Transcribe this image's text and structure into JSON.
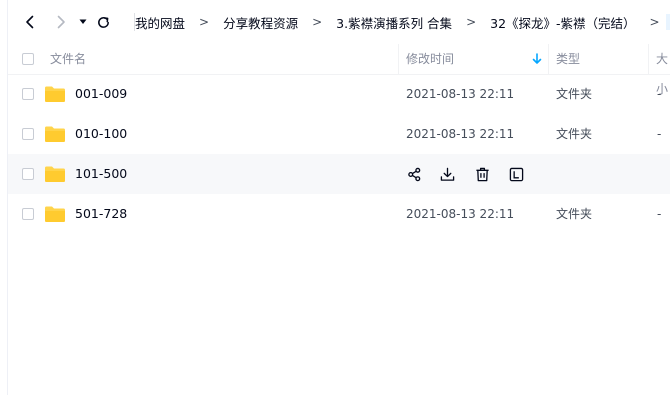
{
  "breadcrumb": {
    "items": [
      "我的网盘",
      "分享教程资源",
      "3.紫襟演播系列 合集",
      "32《探龙》-紫襟（完结）"
    ],
    "separator": ">"
  },
  "table": {
    "headers": {
      "name": "文件名",
      "modified": "修改时间",
      "type": "类型",
      "size": "大小"
    },
    "sort_icon": "arrow-down-icon",
    "rows": [
      {
        "name": "001-009",
        "modified": "2021-08-13 22:11",
        "type": "文件夹",
        "size": "-"
      },
      {
        "name": "010-100",
        "modified": "2021-08-13 22:11",
        "type": "文件夹",
        "size": "-"
      },
      {
        "name": "101-500",
        "modified": "",
        "type": "",
        "size": ""
      },
      {
        "name": "501-728",
        "modified": "2021-08-13 22:11",
        "type": "文件夹",
        "size": "-"
      }
    ],
    "hover_actions": [
      "share-icon",
      "download-icon",
      "delete-icon",
      "rename-icon"
    ]
  },
  "colors": {
    "accent": "#06a7ff",
    "folder": "#ffd44b",
    "hover_row": "#f7f8fa",
    "text": "#03081a",
    "muted": "#878c9c"
  }
}
